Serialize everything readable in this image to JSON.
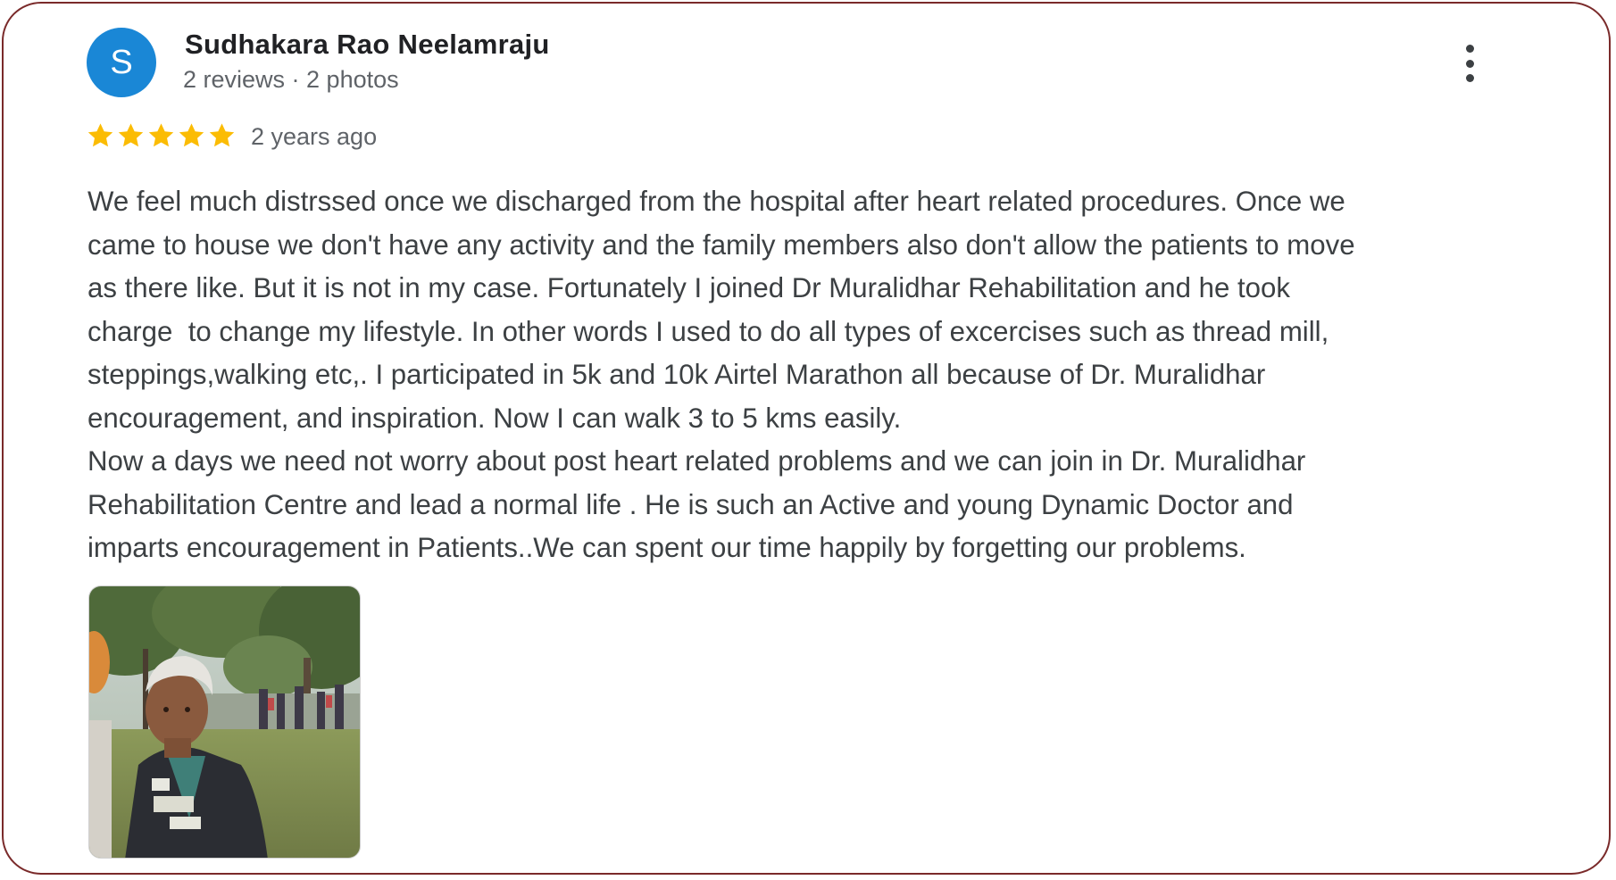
{
  "review": {
    "avatar_initial": "S",
    "author_name": "Sudhakara Rao Neelamraju",
    "author_meta": "2 reviews · 2 photos",
    "rating": 5,
    "max_rating": 5,
    "time_ago": "2 years ago",
    "text_lines": [
      "We feel much distrssed once we discharged from the hospital after heart related procedures. Once we",
      "came to house we don't have any activity and the family members also don't allow the patients to move",
      "as there like. But it is not in my case. Fortunately I joined Dr Muralidhar Rehabilitation and he took",
      "charge  to change my lifestyle. In other words I used to do all types of excercises such as thread mill,",
      "steppings,walking etc,. I participated in 5k and 10k Airtel Marathon all because of Dr. Muralidhar",
      "encouragement, and inspiration. Now I can walk 3 to 5 kms easily.",
      "Now a days we need not worry about post heart related problems and we can join in Dr. Muralidhar",
      "Rehabilitation Centre and lead a normal life . He is such an Active and young Dynamic Doctor and",
      "imparts encouragement in Patients..We can spent our time happily by forgetting our problems."
    ]
  },
  "colors": {
    "avatar_bg": "#1a87d6",
    "star": "#fbbc04",
    "card_border": "#7a2a2a",
    "text": "#3c4043",
    "meta_text": "#5f6368"
  },
  "icons": {
    "more": "more-vert-icon",
    "star": "star-icon"
  }
}
